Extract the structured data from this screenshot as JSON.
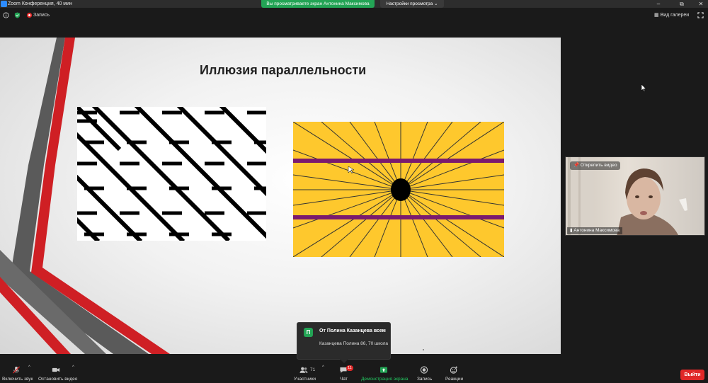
{
  "window": {
    "title": "Zoom Конференция, 40 мин",
    "share_banner": "Вы просматриваете экран Антонина Максимова",
    "view_options": "Настройки просмотра"
  },
  "infobar": {
    "recording_label": "Запись",
    "gallery_view": "Вид галереи"
  },
  "slide": {
    "title": "Иллюзия параллельности"
  },
  "video": {
    "unpin_label": "Открепить видео",
    "participant_name": "Антонина Максимова"
  },
  "chat_popup": {
    "avatar_letter": "П",
    "from": "От Полина Казанцева всем",
    "message": "Казанцева Полина 86, 70 школа"
  },
  "toolbar": {
    "unmute": "Включить звук",
    "stop_video": "Остановить видео",
    "participants": "Участники",
    "participants_count": "71",
    "chat": "Чат",
    "chat_badge": "11",
    "share_screen": "Демонстрация экрана",
    "record": "Запись",
    "reactions": "Реакции",
    "leave": "Выйти"
  },
  "colors": {
    "banner_green": "#23a455",
    "leave_red": "#e02828",
    "illusion_yellow": "#fec82d",
    "illusion_purple": "#7b1a6e"
  }
}
